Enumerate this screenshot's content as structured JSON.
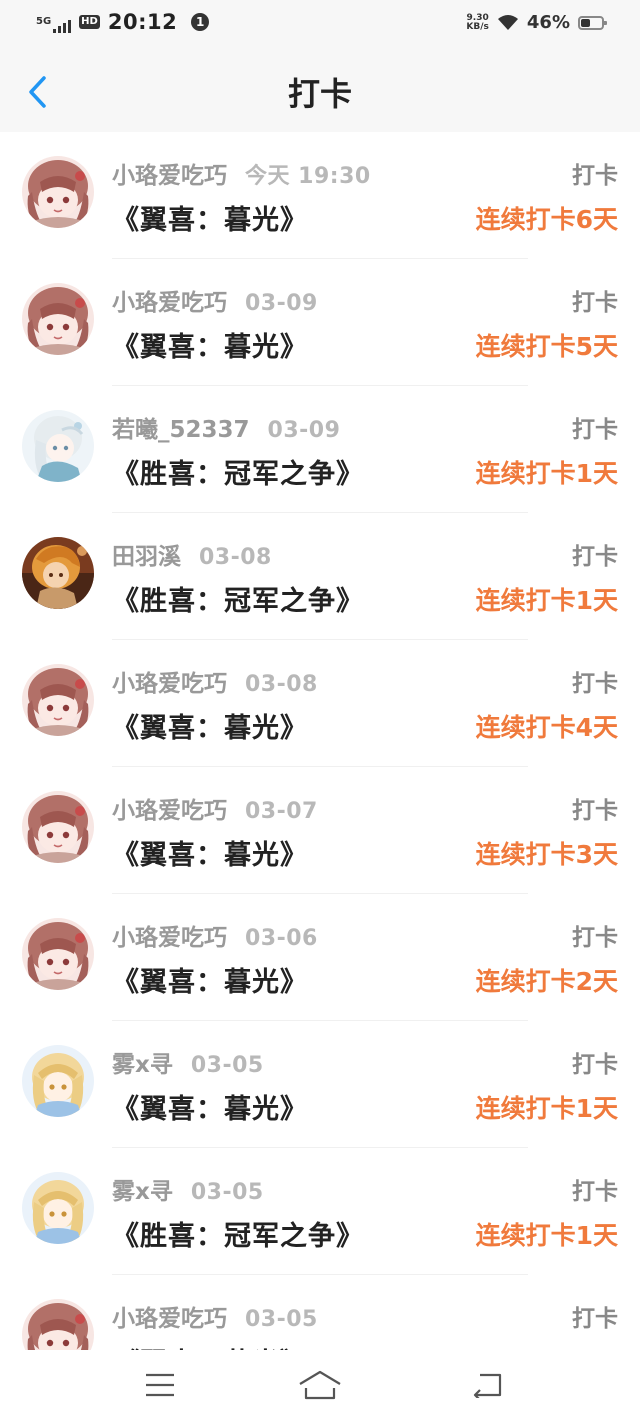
{
  "status_bar": {
    "network": "5G",
    "hd": "HD",
    "time": "20:12",
    "notification_count": "1",
    "speed_value": "9.30",
    "speed_unit": "KB/s",
    "battery": "46%"
  },
  "header": {
    "title": "打卡",
    "back_icon": "chevron-left-icon",
    "accent_color": "#2196f3"
  },
  "colors": {
    "streak": "#f07a3c",
    "username": "#999999",
    "title": "#222222"
  },
  "list": [
    {
      "user": "小珞爱吃巧",
      "time": "今天 19:30",
      "action": "打卡",
      "book": "《翼喜：暮光》",
      "streak": "连续打卡6天",
      "avatar": "pink-hair-avatar"
    },
    {
      "user": "小珞爱吃巧",
      "time": "03-09",
      "action": "打卡",
      "book": "《翼喜：暮光》",
      "streak": "连续打卡5天",
      "avatar": "pink-hair-avatar"
    },
    {
      "user": "若曦_52337",
      "time": "03-09",
      "action": "打卡",
      "book": "《胜喜：冠军之争》",
      "streak": "连续打卡1天",
      "avatar": "white-hair-avatar"
    },
    {
      "user": "田羽溪",
      "time": "03-08",
      "action": "打卡",
      "book": "《胜喜：冠军之争》",
      "streak": "连续打卡1天",
      "avatar": "orange-hair-avatar"
    },
    {
      "user": "小珞爱吃巧",
      "time": "03-08",
      "action": "打卡",
      "book": "《翼喜：暮光》",
      "streak": "连续打卡4天",
      "avatar": "pink-hair-avatar"
    },
    {
      "user": "小珞爱吃巧",
      "time": "03-07",
      "action": "打卡",
      "book": "《翼喜：暮光》",
      "streak": "连续打卡3天",
      "avatar": "pink-hair-avatar"
    },
    {
      "user": "小珞爱吃巧",
      "time": "03-06",
      "action": "打卡",
      "book": "《翼喜：暮光》",
      "streak": "连续打卡2天",
      "avatar": "pink-hair-avatar"
    },
    {
      "user": "雾x寻",
      "time": "03-05",
      "action": "打卡",
      "book": "《翼喜：暮光》",
      "streak": "连续打卡1天",
      "avatar": "blonde-hair-avatar"
    },
    {
      "user": "雾x寻",
      "time": "03-05",
      "action": "打卡",
      "book": "《胜喜：冠军之争》",
      "streak": "连续打卡1天",
      "avatar": "blonde-hair-avatar"
    },
    {
      "user": "小珞爱吃巧",
      "time": "03-05",
      "action": "打卡",
      "book": "《翼喜：暮光》",
      "streak": "",
      "avatar": "pink-hair-avatar"
    }
  ],
  "nav": {
    "menu_icon": "menu-icon",
    "home_icon": "home-icon",
    "back_icon": "back-arrow-icon"
  }
}
